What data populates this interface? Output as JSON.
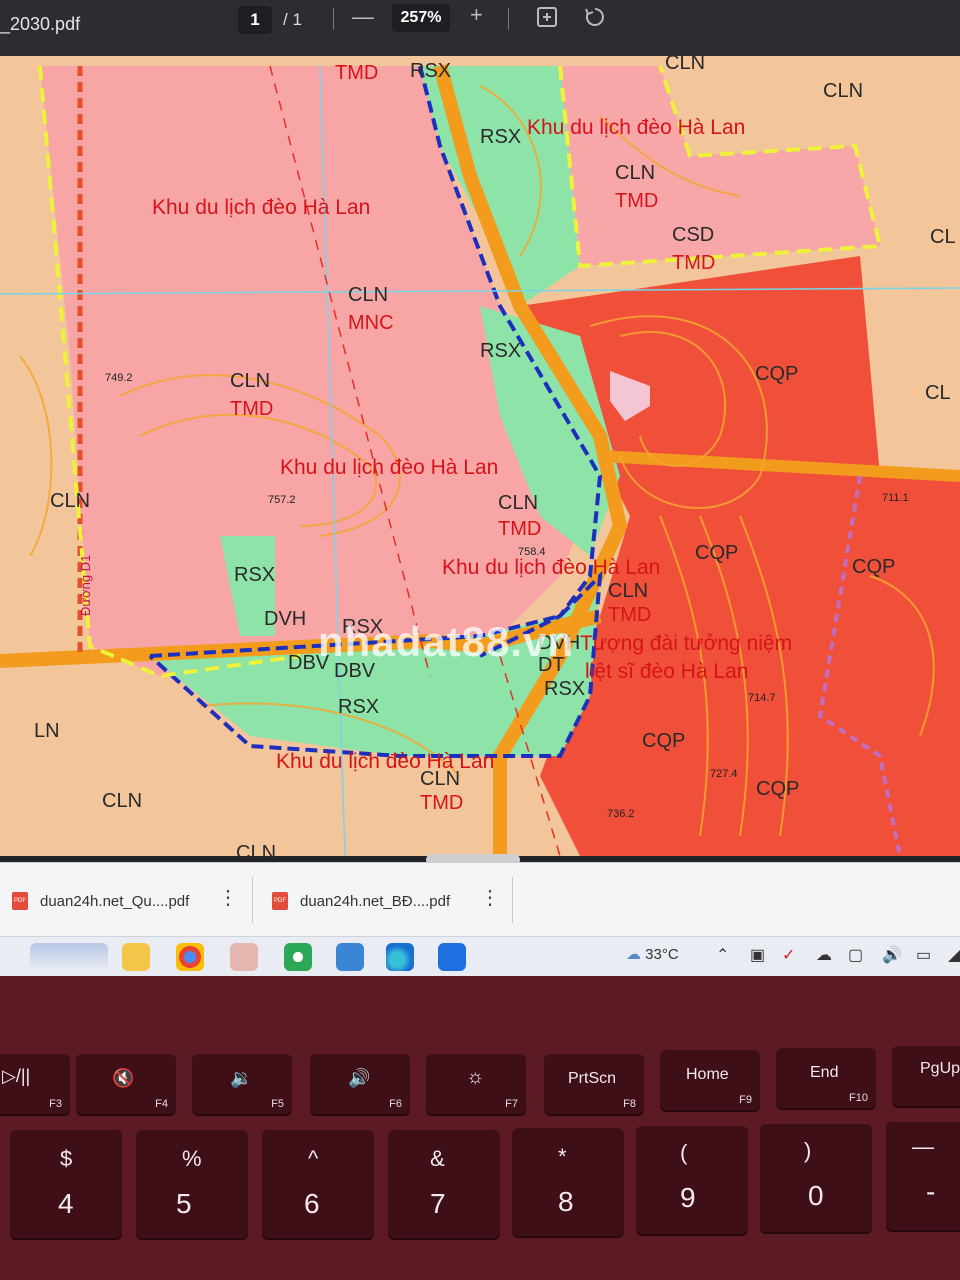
{
  "viewer": {
    "file_name": "_2030.pdf",
    "page_current": "1",
    "page_total": "/ 1",
    "zoom": "257%",
    "minus": "—",
    "plus": "+"
  },
  "map": {
    "codes": [
      "TMD",
      "RSX",
      "CLN",
      "CLN",
      "RSX",
      "CLN",
      "TMD",
      "CSD",
      "TMD",
      "CL",
      "CLN",
      "MNC",
      "RSX",
      "CLN",
      "TMD",
      "CQP",
      "CL",
      "CLN",
      "TMD",
      "CLN",
      "CQP",
      "CQP",
      "RSX",
      "CLN",
      "TMD",
      "DVH",
      "RSX",
      "DBV",
      "DBV",
      "RSX",
      "RSX",
      "CLN",
      "TMD",
      "CQP",
      "CQP",
      "LN",
      "CLN",
      "CLN",
      "DVH",
      "DT"
    ],
    "zones": [
      "Khu du lịch đèo Hà Lan",
      "Khu du lịch đèo Hà Lan",
      "Khu du lịch đèo Hà Lan",
      "Khu du lịch đèo Hà Lan",
      "Khu du lịch đèo Hà Lan",
      "Tượng đài tưởng niệm",
      "liệt sĩ đèo Hà Lan"
    ],
    "elevations": [
      "749.2",
      "757.2",
      "758.4",
      "711.1",
      "714.7",
      "727.4",
      "736.2"
    ],
    "road_label": "Đường D1",
    "watermark": "nhadat88.vn"
  },
  "tabs": [
    {
      "label": "duan24h.net_Qu....pdf"
    },
    {
      "label": "duan24h.net_BĐ....pdf"
    }
  ],
  "taskbar": {
    "weather": "33°C"
  },
  "keyboard": {
    "fkeys": [
      {
        "symbol": "▷/||",
        "fn": "F3"
      },
      {
        "symbol": "🔇",
        "fn": "F4"
      },
      {
        "symbol": "🔉",
        "fn": "F5"
      },
      {
        "symbol": "🔊",
        "fn": "F6"
      },
      {
        "symbol": "☼",
        "fn": "F7"
      },
      {
        "symbol": "PrtScn",
        "fn": "F8"
      },
      {
        "symbol": "Home",
        "fn": "F9"
      },
      {
        "symbol": "End",
        "fn": "F10"
      },
      {
        "symbol": "PgUp",
        "fn": ""
      }
    ],
    "numkeys": [
      {
        "top": "$",
        "main": "4"
      },
      {
        "top": "%",
        "main": "5"
      },
      {
        "top": "^",
        "main": "6"
      },
      {
        "top": "&",
        "main": "7"
      },
      {
        "top": "*",
        "main": "8"
      },
      {
        "top": "(",
        "main": "9"
      },
      {
        "top": ")",
        "main": "0"
      },
      {
        "top": "—",
        "main": "-"
      }
    ]
  }
}
